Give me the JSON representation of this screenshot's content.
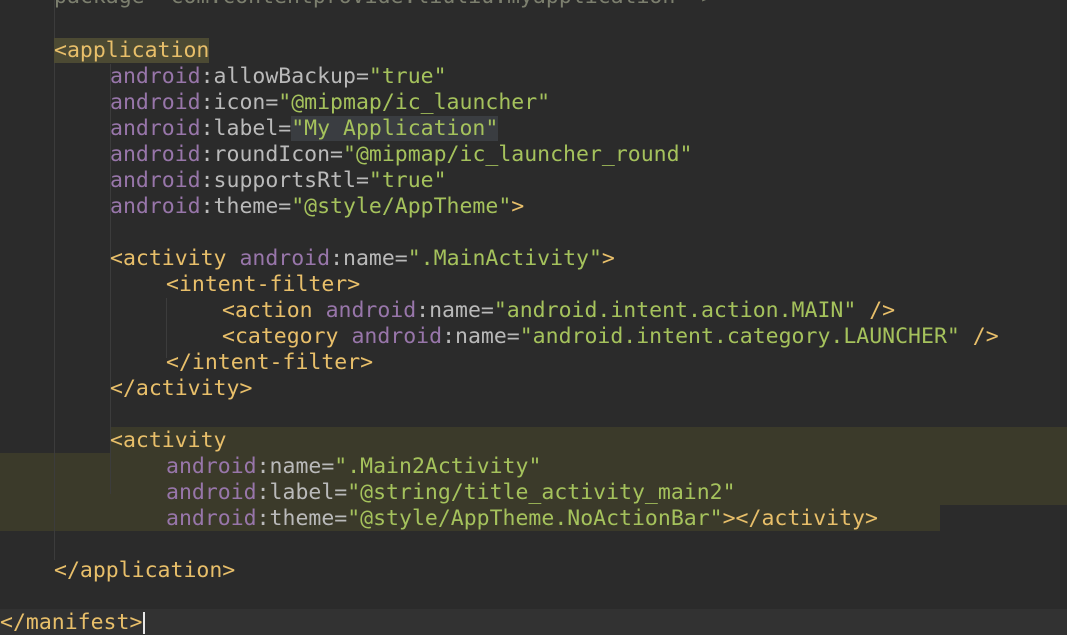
{
  "lines": [
    [
      {
        "t": "package=\"com.contentprovide.liuliu.myapplication\" >",
        "c": "val faded"
      }
    ],
    [],
    [
      {
        "t": "<application",
        "c": "tag hl-app"
      }
    ],
    [
      {
        "t": "android",
        "c": "ns"
      },
      {
        "t": ":allowBackup=",
        "c": "attr"
      },
      {
        "t": "\"true\"",
        "c": "val"
      }
    ],
    [
      {
        "t": "android",
        "c": "ns"
      },
      {
        "t": ":icon=",
        "c": "attr"
      },
      {
        "t": "\"@mipmap/ic_launcher\"",
        "c": "val"
      }
    ],
    [
      {
        "t": "android",
        "c": "ns"
      },
      {
        "t": ":label=",
        "c": "attr"
      },
      {
        "t": "\"My Application\"",
        "c": "val hl-sel"
      }
    ],
    [
      {
        "t": "android",
        "c": "ns"
      },
      {
        "t": ":roundIcon=",
        "c": "attr"
      },
      {
        "t": "\"@mipmap/ic_launcher_round\"",
        "c": "val"
      }
    ],
    [
      {
        "t": "android",
        "c": "ns"
      },
      {
        "t": ":supportsRtl=",
        "c": "attr"
      },
      {
        "t": "\"true\"",
        "c": "val"
      }
    ],
    [
      {
        "t": "android",
        "c": "ns"
      },
      {
        "t": ":theme=",
        "c": "attr"
      },
      {
        "t": "\"@style/AppTheme\"",
        "c": "val"
      },
      {
        "t": ">",
        "c": "punc"
      }
    ],
    [],
    [
      {
        "t": "<activity ",
        "c": "tag"
      },
      {
        "t": "android",
        "c": "ns"
      },
      {
        "t": ":name=",
        "c": "attr"
      },
      {
        "t": "\".MainActivity\"",
        "c": "val"
      },
      {
        "t": ">",
        "c": "punc"
      }
    ],
    [
      {
        "t": "<intent-filter>",
        "c": "tag"
      }
    ],
    [
      {
        "t": "<action ",
        "c": "tag"
      },
      {
        "t": "android",
        "c": "ns"
      },
      {
        "t": ":name=",
        "c": "attr"
      },
      {
        "t": "\"android.intent.action.MAIN\"",
        "c": "val"
      },
      {
        "t": " />",
        "c": "punc"
      }
    ],
    [
      {
        "t": "<category ",
        "c": "tag"
      },
      {
        "t": "android",
        "c": "ns"
      },
      {
        "t": ":name=",
        "c": "attr"
      },
      {
        "t": "\"android.intent.category.LAUNCHER\"",
        "c": "val"
      },
      {
        "t": " />",
        "c": "punc"
      }
    ],
    [
      {
        "t": "</intent-filter>",
        "c": "tag"
      }
    ],
    [
      {
        "t": "</activity>",
        "c": "tag"
      }
    ],
    [],
    [
      {
        "t": "<activity",
        "c": "tag"
      }
    ],
    [
      {
        "t": "android",
        "c": "ns"
      },
      {
        "t": ":name=",
        "c": "attr"
      },
      {
        "t": "\".Main2Activity\"",
        "c": "val"
      }
    ],
    [
      {
        "t": "android",
        "c": "ns"
      },
      {
        "t": ":label=",
        "c": "attr"
      },
      {
        "t": "\"@string/title_activity_main2\"",
        "c": "val"
      }
    ],
    [
      {
        "t": "android",
        "c": "ns"
      },
      {
        "t": ":theme=",
        "c": "attr"
      },
      {
        "t": "\"@style/AppTheme.NoActionBar\"",
        "c": "val"
      },
      {
        "t": "></activity>",
        "c": "punc"
      }
    ],
    [],
    [
      {
        "t": "</application>",
        "c": "tag"
      }
    ],
    [],
    [
      {
        "t": "</manifest>",
        "c": "tag"
      }
    ]
  ],
  "colors": {
    "background": "#2b2b2b",
    "tag": "#e8bf6a",
    "namespace": "#9876aa",
    "attribute": "#bababa",
    "value": "#a5c25c",
    "active_block_highlight": "#3b3a2a",
    "caret_line": "#323232"
  }
}
